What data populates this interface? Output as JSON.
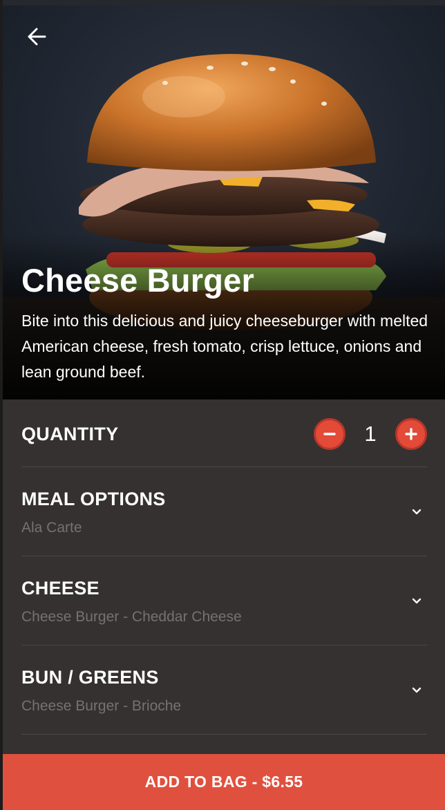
{
  "hero": {
    "title": "Cheese Burger",
    "description": "Bite into this delicious and juicy cheeseburger with melted American cheese, fresh tomato, crisp lettuce, onions and lean ground beef.",
    "back_icon": "arrow-left-icon"
  },
  "quantity": {
    "label": "QUANTITY",
    "value": "1",
    "decrement_icon": "minus-icon",
    "increment_icon": "plus-icon"
  },
  "options": [
    {
      "label": "MEAL OPTIONS",
      "value": "Ala Carte"
    },
    {
      "label": "CHEESE",
      "value": "Cheese Burger - Cheddar Cheese"
    },
    {
      "label": "BUN / GREENS",
      "value": "Cheese Burger - Brioche"
    }
  ],
  "cart": {
    "add_label": "ADD TO BAG - $6.55"
  },
  "colors": {
    "accent": "#e0503e",
    "panel": "#353131",
    "muted_text": "#77716f"
  }
}
